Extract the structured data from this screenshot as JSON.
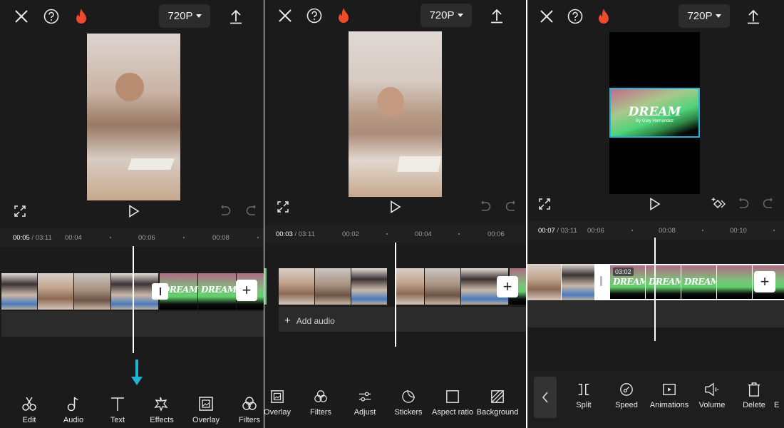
{
  "colors": {
    "accent_cyan": "#1fb4d6",
    "fire": "#ee4b2b",
    "panel_bg": "#1b1b1b"
  },
  "panels": [
    {
      "topbar": {
        "close_icon": "close-icon",
        "help_icon": "help-icon",
        "fire_icon": "fire-icon",
        "resolution": "720P",
        "export_icon": "upload-icon"
      },
      "timeline": {
        "current": "00:05",
        "total": "/ 03:11",
        "ticks": [
          "00:04",
          "00:06",
          "00:08"
        ]
      },
      "tools": [
        {
          "label": "Edit",
          "icon": "scissors-icon"
        },
        {
          "label": "Audio",
          "icon": "music-note-icon"
        },
        {
          "label": "Text",
          "icon": "text-icon"
        },
        {
          "label": "Effects",
          "icon": "star-effects-icon"
        },
        {
          "label": "Overlay",
          "icon": "overlay-icon"
        },
        {
          "label": "Filters",
          "icon": "filters-icon"
        }
      ],
      "clip_overlay": "DREAM"
    },
    {
      "topbar": {
        "close_icon": "close-icon",
        "help_icon": "help-icon",
        "fire_icon": "fire-icon",
        "resolution": "720P",
        "export_icon": "upload-icon"
      },
      "timeline": {
        "current": "00:03",
        "total": "/ 03:11",
        "ticks": [
          "00:02",
          "00:04",
          "00:06"
        ]
      },
      "add_audio": "Add audio",
      "tools": [
        {
          "label": "Overlay",
          "icon": "overlay-icon"
        },
        {
          "label": "Filters",
          "icon": "filters-icon"
        },
        {
          "label": "Adjust",
          "icon": "adjust-icon"
        },
        {
          "label": "Stickers",
          "icon": "sticker-icon"
        },
        {
          "label": "Aspect ratio",
          "icon": "aspect-ratio-icon"
        },
        {
          "label": "Background",
          "icon": "background-icon"
        }
      ]
    },
    {
      "topbar": {
        "close_icon": "close-icon",
        "help_icon": "help-icon",
        "fire_icon": "fire-icon",
        "resolution": "720P",
        "export_icon": "upload-icon"
      },
      "timeline": {
        "current": "00:07",
        "total": "/ 03:11",
        "ticks": [
          "00:06",
          "00:08",
          "00:10"
        ]
      },
      "clip_duration": "03:02",
      "preview_title": "DREAM",
      "preview_sub": "By Gary Hernandez",
      "tools": [
        {
          "label": "Split",
          "icon": "split-icon"
        },
        {
          "label": "Speed",
          "icon": "speed-icon"
        },
        {
          "label": "Animations",
          "icon": "animations-icon"
        },
        {
          "label": "Volume",
          "icon": "volume-icon"
        },
        {
          "label": "Delete",
          "icon": "delete-icon"
        },
        {
          "label": "E",
          "icon": ""
        }
      ]
    }
  ]
}
